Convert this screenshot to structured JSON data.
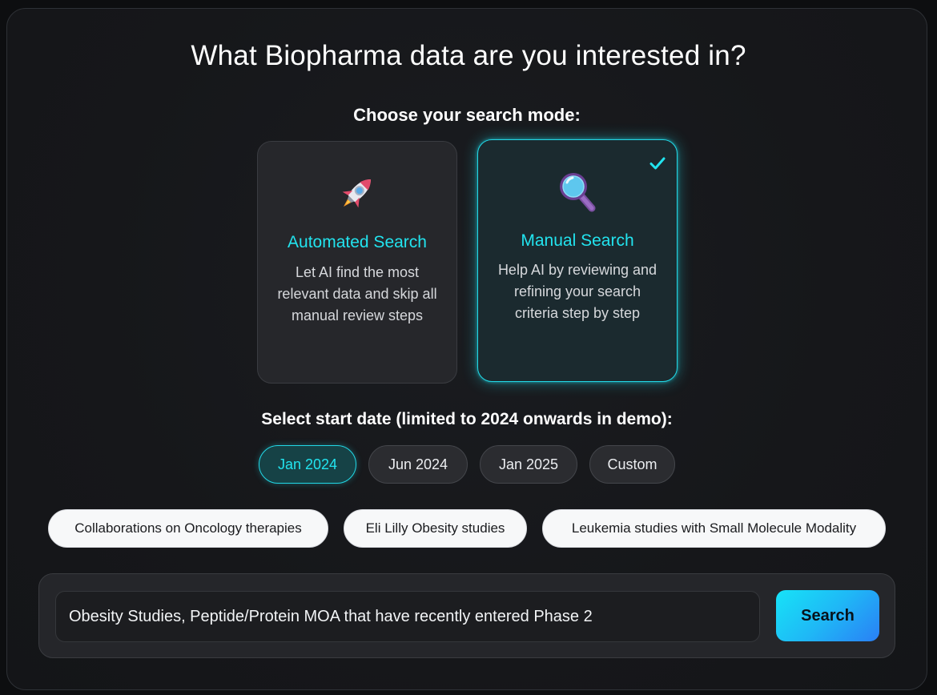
{
  "header": {
    "title": "What Biopharma data are you interested in?"
  },
  "mode": {
    "label": "Choose your search mode:",
    "options": [
      {
        "title": "Automated Search",
        "description": "Let AI find the most relevant data and skip all manual review steps",
        "icon": "rocket-icon",
        "selected": false
      },
      {
        "title": "Manual Search",
        "description": "Help AI by reviewing and refining your search criteria step by step",
        "icon": "magnifier-icon",
        "selected": true
      }
    ]
  },
  "dates": {
    "label": "Select start date (limited to 2024 onwards in demo):",
    "options": [
      "Jan 2024",
      "Jun 2024",
      "Jan 2025",
      "Custom"
    ],
    "selected": "Jan 2024"
  },
  "suggestions": [
    "Collaborations on Oncology therapies",
    "Eli Lilly Obesity studies",
    "Leukemia studies with Small Molecule Modality"
  ],
  "search": {
    "value": "Obesity Studies, Peptide/Protein MOA that have recently entered Phase 2",
    "button_label": "Search"
  },
  "colors": {
    "accent": "#22e4ef",
    "panel_bg": "#16171a",
    "button_gradient_start": "#17e3f7",
    "button_gradient_end": "#2a7ff5"
  }
}
